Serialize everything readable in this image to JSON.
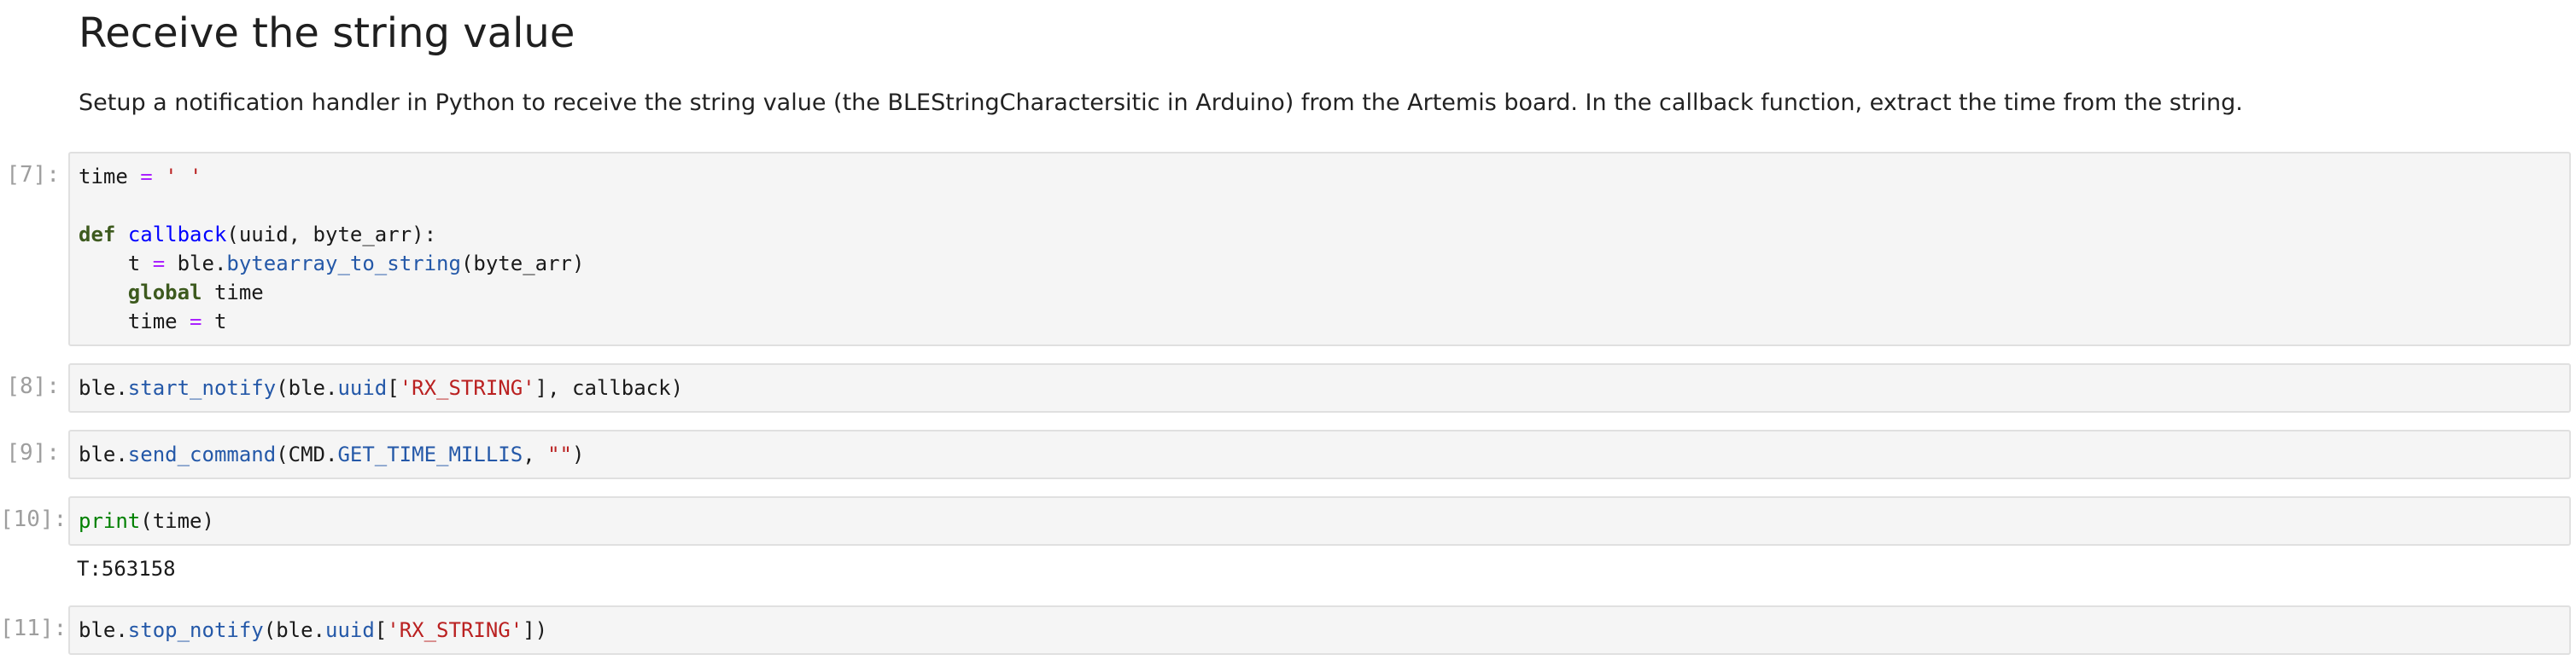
{
  "markdown": {
    "heading": "Receive the string value",
    "paragraph": "Setup a notification handler in Python to receive the string value (the BLEStringCharactersitic in Arduino) from the Artemis board. In the callback function, extract the time from the string."
  },
  "cells": [
    {
      "prompt": "[7]:",
      "lines": [
        [
          {
            "t": "time ",
            "c": "plain"
          },
          {
            "t": "=",
            "c": "op"
          },
          {
            "t": " ",
            "c": "plain"
          },
          {
            "t": "' '",
            "c": "str"
          }
        ],
        [],
        [
          {
            "t": "def",
            "c": "def"
          },
          {
            "t": " ",
            "c": "plain"
          },
          {
            "t": "callback",
            "c": "fn"
          },
          {
            "t": "(uuid, byte_arr):",
            "c": "plain"
          }
        ],
        [
          {
            "t": "    t ",
            "c": "plain"
          },
          {
            "t": "=",
            "c": "op"
          },
          {
            "t": " ble.",
            "c": "plain"
          },
          {
            "t": "bytearray_to_string",
            "c": "attr"
          },
          {
            "t": "(byte_arr)",
            "c": "plain"
          }
        ],
        [
          {
            "t": "    ",
            "c": "plain"
          },
          {
            "t": "global",
            "c": "def"
          },
          {
            "t": " time",
            "c": "plain"
          }
        ],
        [
          {
            "t": "    time ",
            "c": "plain"
          },
          {
            "t": "=",
            "c": "op"
          },
          {
            "t": " t",
            "c": "plain"
          }
        ]
      ],
      "output": ""
    },
    {
      "prompt": "[8]:",
      "lines": [
        [
          {
            "t": "ble.",
            "c": "plain"
          },
          {
            "t": "start_notify",
            "c": "attr"
          },
          {
            "t": "(ble.",
            "c": "plain"
          },
          {
            "t": "uuid",
            "c": "attr"
          },
          {
            "t": "[",
            "c": "plain"
          },
          {
            "t": "'RX_STRING'",
            "c": "str"
          },
          {
            "t": "], callback)",
            "c": "plain"
          }
        ]
      ],
      "output": ""
    },
    {
      "prompt": "[9]:",
      "lines": [
        [
          {
            "t": "ble.",
            "c": "plain"
          },
          {
            "t": "send_command",
            "c": "attr"
          },
          {
            "t": "(CMD.",
            "c": "plain"
          },
          {
            "t": "GET_TIME_MILLIS",
            "c": "attr"
          },
          {
            "t": ", ",
            "c": "plain"
          },
          {
            "t": "\"\"",
            "c": "str"
          },
          {
            "t": ")",
            "c": "plain"
          }
        ]
      ],
      "output": ""
    },
    {
      "prompt": "[10]:",
      "lines": [
        [
          {
            "t": "print",
            "c": "builtin"
          },
          {
            "t": "(time)",
            "c": "plain"
          }
        ]
      ],
      "output": "T:563158"
    },
    {
      "prompt": "[11]:",
      "lines": [
        [
          {
            "t": "ble.",
            "c": "plain"
          },
          {
            "t": "stop_notify",
            "c": "attr"
          },
          {
            "t": "(ble.",
            "c": "plain"
          },
          {
            "t": "uuid",
            "c": "attr"
          },
          {
            "t": "[",
            "c": "plain"
          },
          {
            "t": "'RX_STRING'",
            "c": "str"
          },
          {
            "t": "])",
            "c": "plain"
          }
        ]
      ],
      "output": ""
    }
  ],
  "colors": {
    "cell_background": "#f5f5f5",
    "cell_border": "#e0e0e0",
    "prompt": "#9e9e9e",
    "keyword": "#3d5a1e",
    "string": "#ba2121",
    "operator": "#aa22ff",
    "function_name": "#0000ff",
    "attribute": "#2458a8"
  }
}
